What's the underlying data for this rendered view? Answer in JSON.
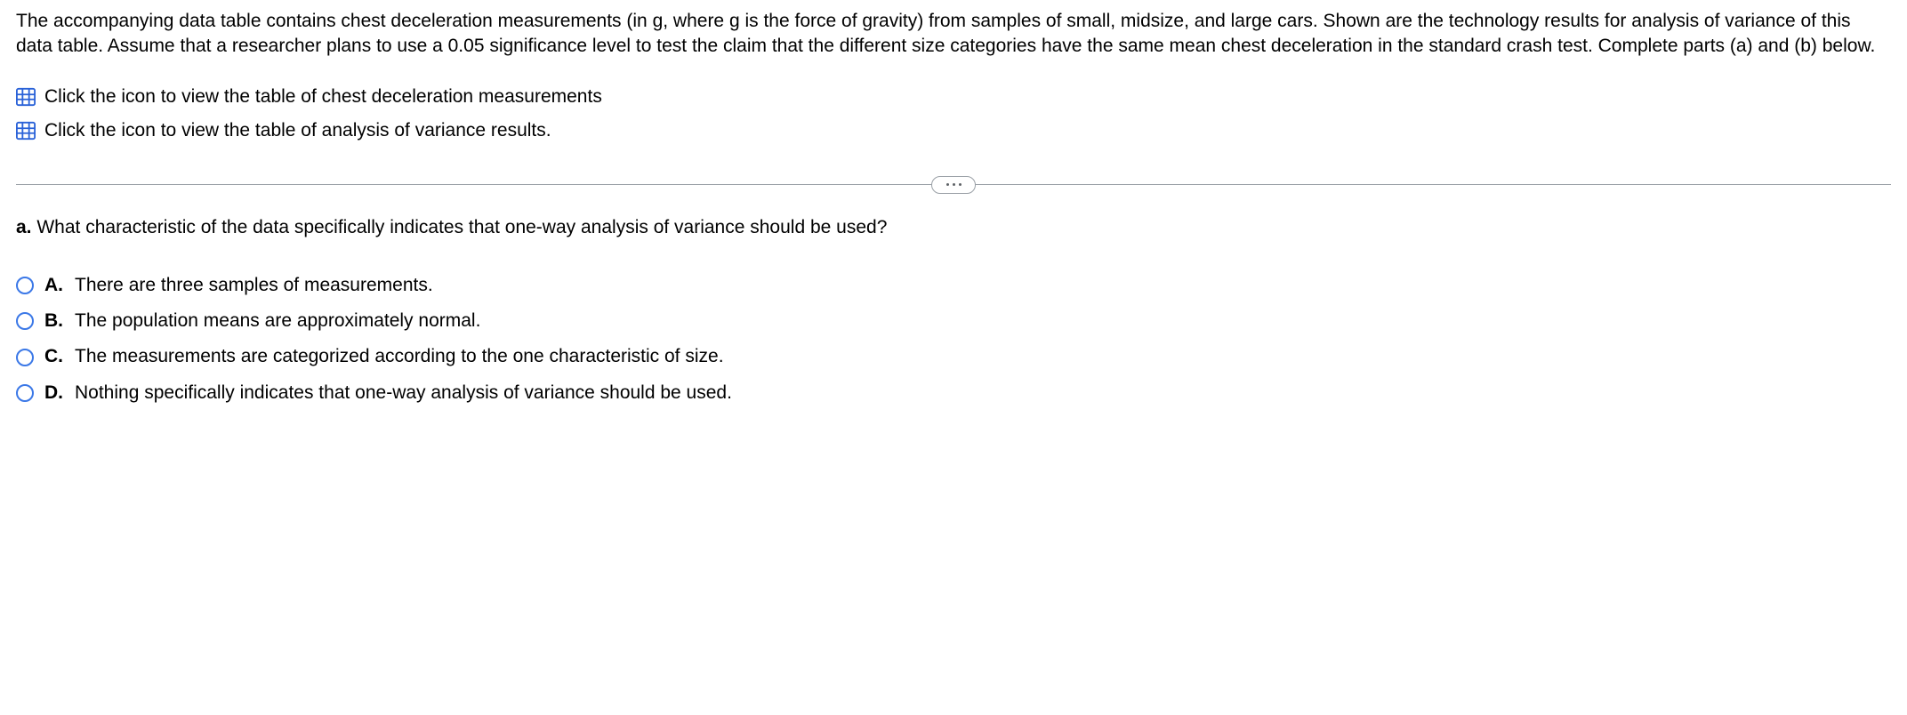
{
  "intro": "The accompanying data table contains chest deceleration measurements (in g, where g is the force of gravity) from samples of small, midsize, and large cars. Shown are the technology results for analysis of variance of this data table. Assume that a researcher plans to use a 0.05 significance level to test the claim that the different size categories have the same mean chest deceleration in the standard crash test. Complete parts (a) and (b) below.",
  "links": {
    "measurements": "Click the icon to view the table of chest deceleration measurements",
    "anova": "Click the icon to view the table of analysis of variance results."
  },
  "question": {
    "label": "a.",
    "text": "What characteristic of the data specifically indicates that one-way analysis of variance should be used?"
  },
  "options": [
    {
      "letter": "A.",
      "text": "There are three samples of measurements."
    },
    {
      "letter": "B.",
      "text": "The population means are approximately normal."
    },
    {
      "letter": "C.",
      "text": "The measurements are categorized according to the one characteristic of size."
    },
    {
      "letter": "D.",
      "text": "Nothing specifically indicates that one-way analysis of variance should be used."
    }
  ]
}
